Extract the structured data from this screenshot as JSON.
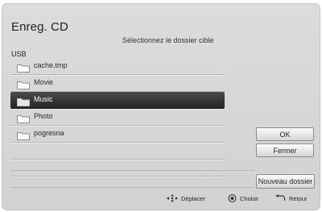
{
  "window": {
    "title": "Enreg. CD",
    "subtitle": "Sélectionnez le dossier cible"
  },
  "source": {
    "label": "USB"
  },
  "folders": [
    {
      "name": "cache,tmp",
      "selected": false
    },
    {
      "name": "Movie",
      "selected": false
    },
    {
      "name": "Music",
      "selected": true
    },
    {
      "name": "Photo",
      "selected": false
    },
    {
      "name": "pogresna",
      "selected": false
    }
  ],
  "buttons": {
    "ok": "OK",
    "close": "Fermer",
    "new_folder": "Nouveau dossier"
  },
  "hints": {
    "move": "Déplacer",
    "select": "Choisir",
    "back": "Retour"
  },
  "icons": {
    "folder": "folder-icon",
    "move": "four-way-arrows-icon",
    "select": "enter-button-icon",
    "back": "return-arrow-icon"
  },
  "colors": {
    "selected_row": "#2f2f2f",
    "background": "#d7d7d7"
  }
}
